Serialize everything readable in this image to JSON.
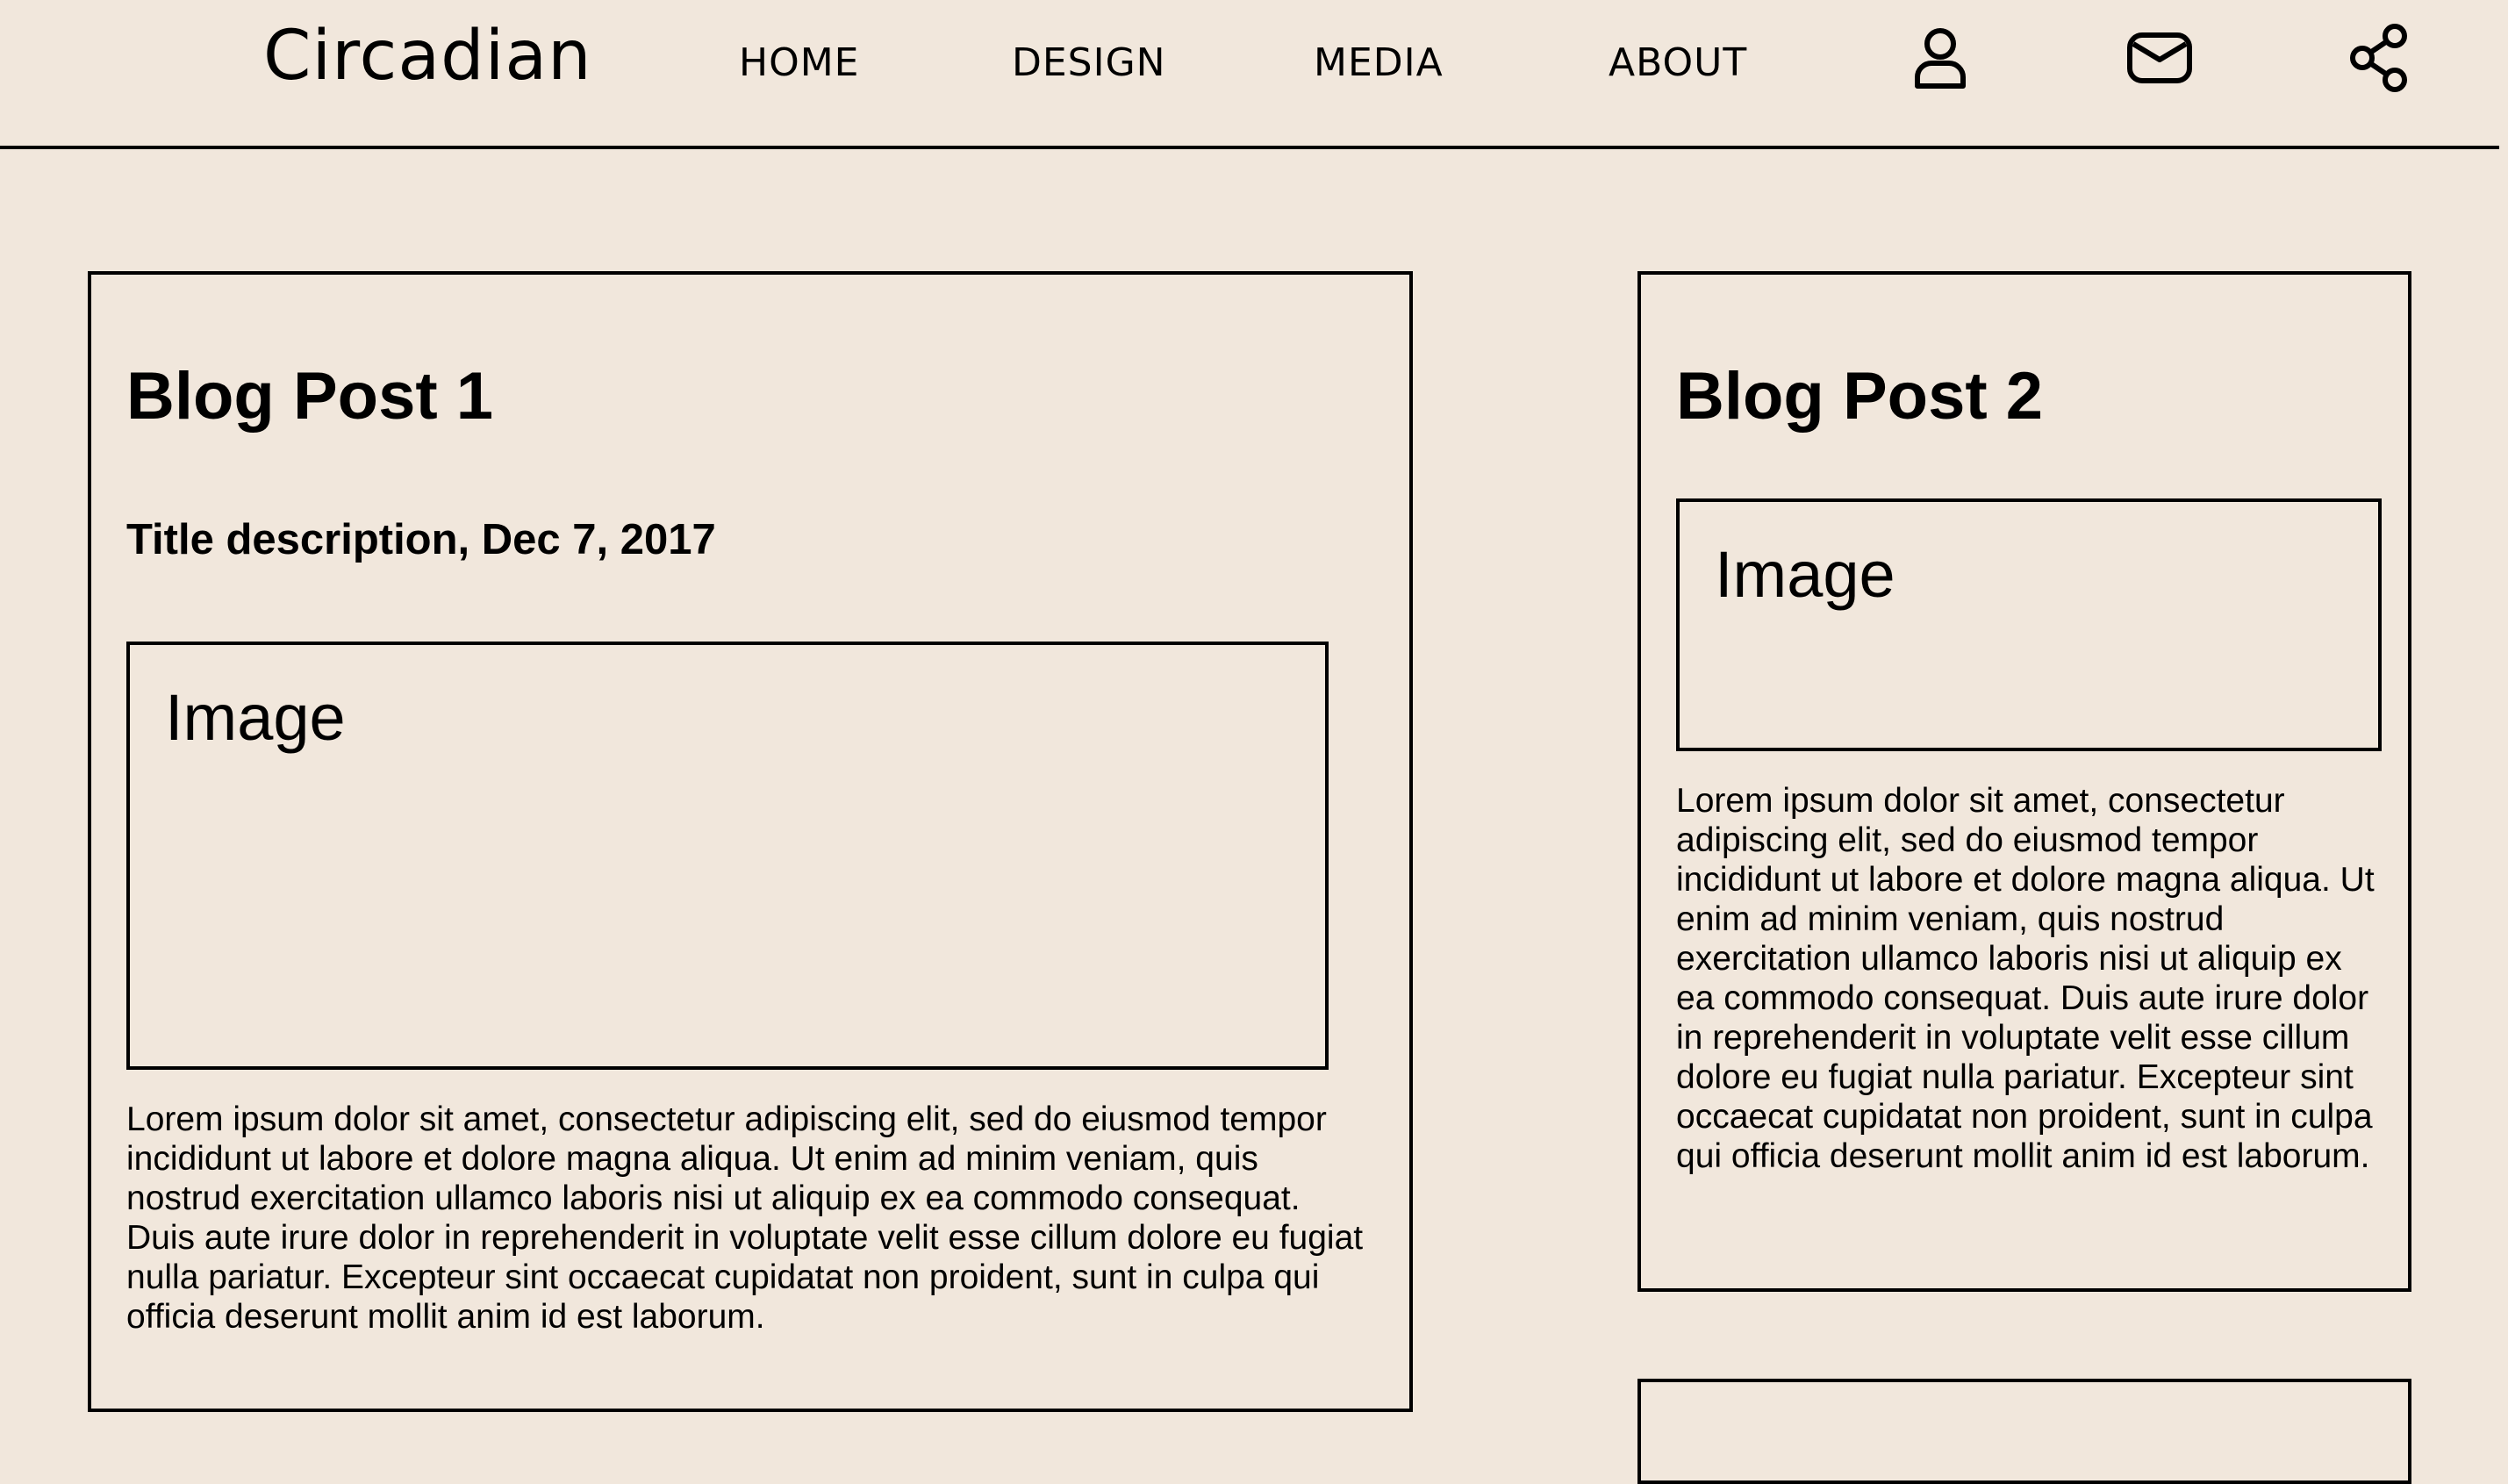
{
  "header": {
    "logo": "Circadian",
    "nav": [
      "HOME",
      "DESIGN",
      "MEDIA",
      "ABOUT"
    ],
    "icons": [
      "user-icon",
      "mail-icon",
      "share-icon"
    ]
  },
  "posts": [
    {
      "title": "Blog Post 1",
      "subtitle": "Title description, Dec 7, 2017",
      "image_label": "Image",
      "body": "Lorem ipsum dolor sit amet, consectetur adipiscing elit, sed do eiusmod tempor incididunt ut labore et dolore magna aliqua. Ut enim ad minim veniam, quis nostrud exercitation ullamco laboris nisi ut aliquip ex ea commodo consequat. Duis aute irure dolor in reprehenderit in voluptate velit esse cillum dolore eu fugiat nulla pariatur. Excepteur sint occaecat cupidatat non proident, sunt in culpa qui officia deserunt mollit anim id est laborum."
    },
    {
      "title": "Blog Post 2",
      "image_label": "Image",
      "body": "Lorem ipsum dolor sit amet, consectetur adipiscing elit, sed do eiusmod tempor incididunt ut labore et dolore magna aliqua. Ut enim ad minim veniam, quis nostrud exercitation ullamco laboris nisi ut aliquip ex ea commodo consequat. Duis aute irure dolor in reprehenderit in voluptate velit esse cillum dolore eu fugiat nulla pariatur. Excepteur sint occaecat cupidatat non proident, sunt in culpa qui officia deserunt mollit anim id est laborum."
    }
  ],
  "colors": {
    "background": "#f1e7dc",
    "ink": "#000000"
  }
}
